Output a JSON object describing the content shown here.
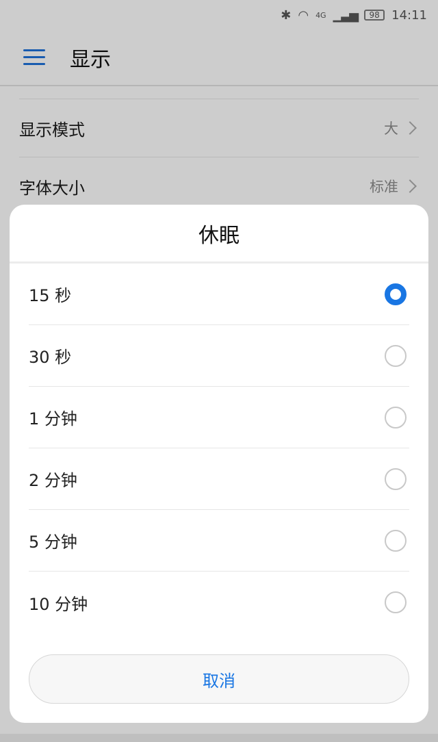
{
  "status_bar": {
    "bluetooth_icon": "bluetooth-icon",
    "wifi_icon": "wifi-icon",
    "network": "4G",
    "battery": "98",
    "time": "14:11"
  },
  "appbar": {
    "menu_icon": "menu-icon",
    "title": "显示"
  },
  "settings": [
    {
      "label": "显示模式",
      "value": "大"
    },
    {
      "label": "字体大小",
      "value": "标准"
    }
  ],
  "dialog": {
    "title": "休眠",
    "options": [
      {
        "label": "15 秒",
        "selected": true
      },
      {
        "label": "30 秒",
        "selected": false
      },
      {
        "label": "1 分钟",
        "selected": false
      },
      {
        "label": "2 分钟",
        "selected": false
      },
      {
        "label": "5 分钟",
        "selected": false
      },
      {
        "label": "10 分钟",
        "selected": false
      }
    ],
    "cancel_label": "取消"
  },
  "colors": {
    "accent": "#1976e3",
    "menu_icon": "#1e6fd6"
  }
}
